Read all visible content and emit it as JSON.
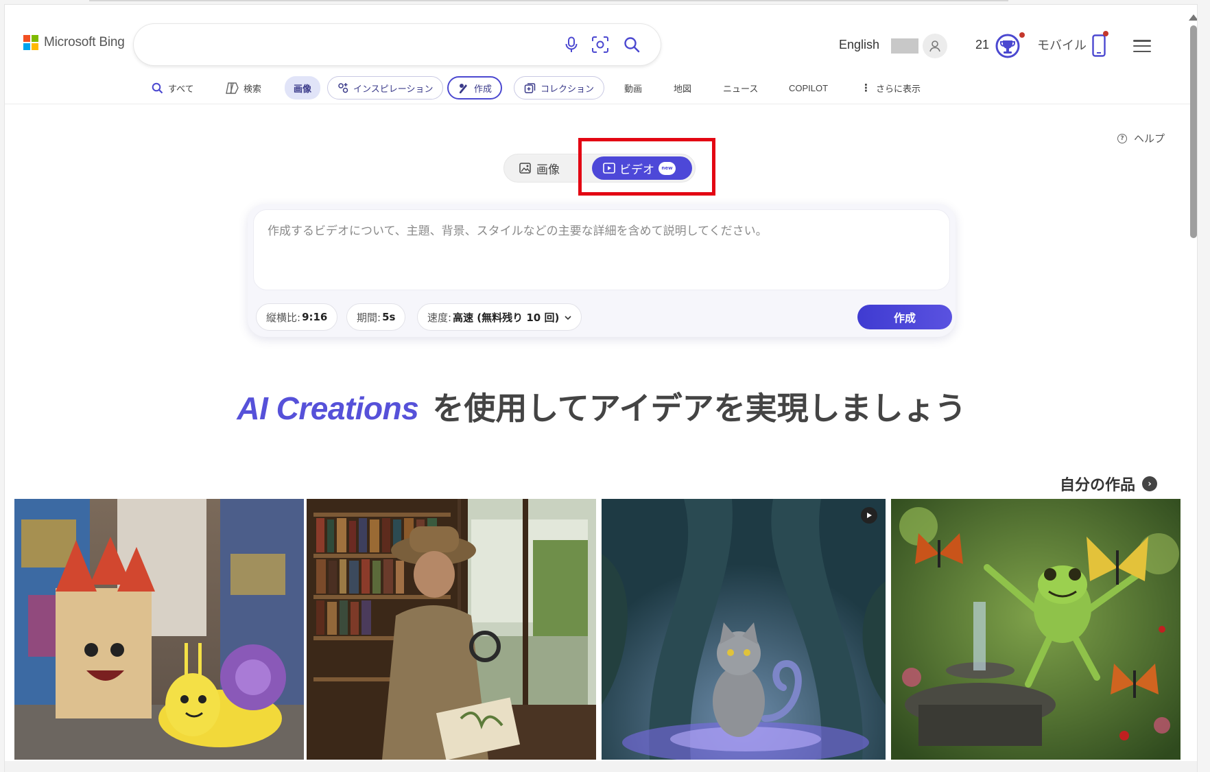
{
  "header": {
    "logo_text": "Microsoft Bing",
    "search_value": "",
    "language": "English",
    "points": "21",
    "mobile_label": "モバイル"
  },
  "nav": {
    "items": [
      {
        "label": "すべて"
      },
      {
        "label": "検索"
      },
      {
        "label": "画像"
      },
      {
        "label": "インスピレーション"
      },
      {
        "label": "作成"
      },
      {
        "label": "コレクション"
      },
      {
        "label": "動画"
      },
      {
        "label": "地図"
      },
      {
        "label": "ニュース"
      },
      {
        "label": "COPILOT"
      },
      {
        "label": "さらに表示"
      }
    ]
  },
  "help_label": "ヘルプ",
  "mode_toggle": {
    "image_label": "画像",
    "video_label": "ビデオ",
    "new_badge": "new"
  },
  "prompt": {
    "placeholder": "作成するビデオについて、主題、背景、スタイルなどの主要な詳細を含めて説明してください。",
    "aspect_label": "縦横比:",
    "aspect_value": "9:16",
    "duration_label": "期間:",
    "duration_value": "5s",
    "speed_label": "速度:",
    "speed_value": "高速 (無料残り 10 回)",
    "create_label": "作成"
  },
  "headline": {
    "brand": "AI Creations",
    "text": "を使用してアイデアを実現しましょう"
  },
  "my_creations_label": "自分の作品",
  "colors": {
    "accent": "#4d48d8",
    "highlight_box": "#e30613"
  },
  "gallery": [
    {
      "icon": "castle-and-snail-image"
    },
    {
      "icon": "explorer-library-image"
    },
    {
      "icon": "forest-cat-video"
    },
    {
      "icon": "frog-butterflies-image"
    }
  ]
}
